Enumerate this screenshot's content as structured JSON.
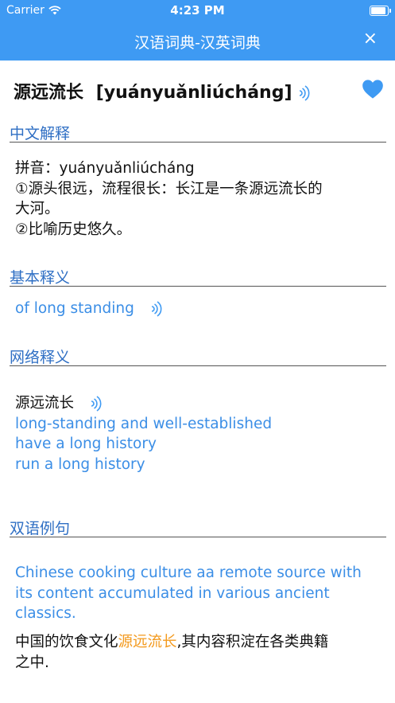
{
  "status_bar": {
    "carrier": "Carrier",
    "time": "4:23 PM",
    "battery_level": 0.9
  },
  "nav": {
    "title": "汉语词典-汉英词典",
    "close_label": "×"
  },
  "entry": {
    "headword": "源远流长",
    "pinyin": "[yuányuǎnliúcháng]",
    "favorited": true
  },
  "sections": {
    "chinese": {
      "title": "中文解释",
      "pinyin_line": "拼音：yuányuǎnliúcháng",
      "def1_line1": "①源头很远，流程很长：长江是一条源远流长的",
      "def1_line2": "大河。",
      "def2": "②比喻历史悠久。"
    },
    "basic": {
      "title": "基本释义",
      "translation": "of long standing"
    },
    "web": {
      "title": "网络释义",
      "term": "源远流长",
      "items": [
        "long-standing and well-established",
        "have a long history",
        "run a long history"
      ]
    },
    "bilingual": {
      "title": "双语例句",
      "en_lines": [
        "Chinese cooking culture aa remote source with",
        "its content accumulated in various ancient",
        "classics."
      ],
      "zh_prefix": "中国的饮食文化",
      "zh_highlight": "源远流长",
      "zh_suffix": ",其内容积淀在各类典籍",
      "zh_line2": "之中."
    }
  },
  "colors": {
    "accent": "#3e9af3",
    "section_title": "#2f6fc4",
    "english_text": "#3b8ee6",
    "highlight": "#f39a1e",
    "heart": "#3e9af3"
  },
  "icons": [
    "wifi-icon",
    "battery-icon",
    "close-icon",
    "speaker-icon",
    "heart-icon"
  ]
}
